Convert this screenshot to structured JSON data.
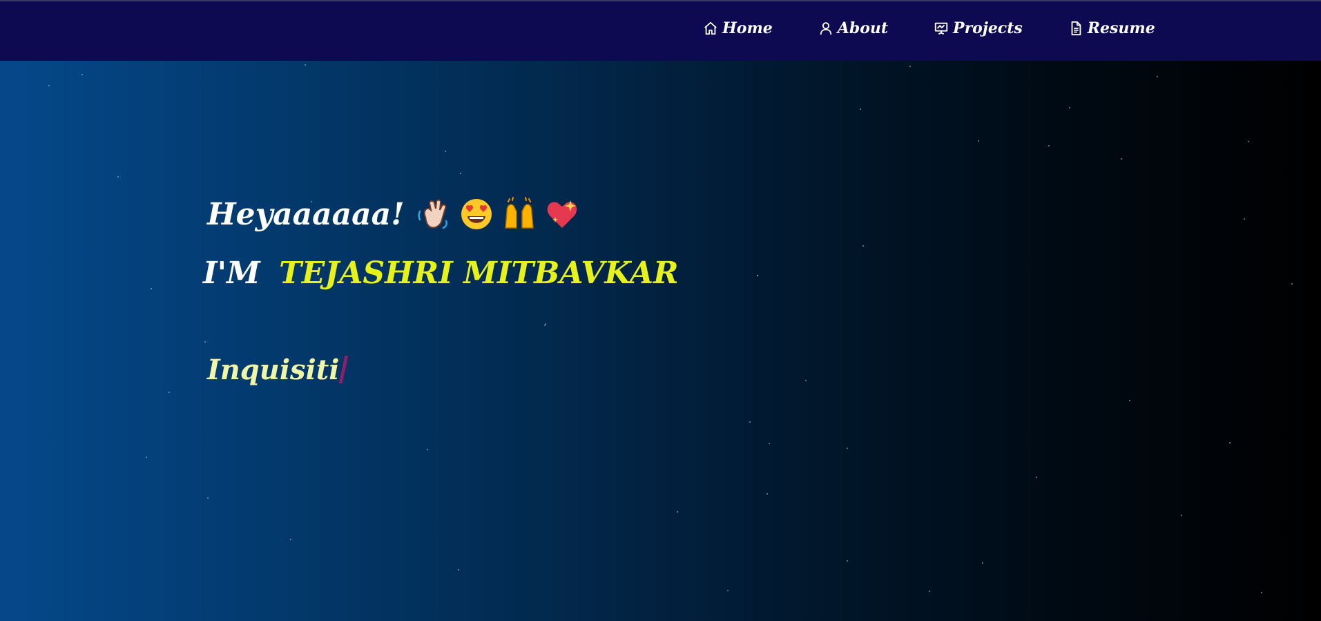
{
  "nav": {
    "items": [
      {
        "label": "Home",
        "icon": "home-icon"
      },
      {
        "label": "About",
        "icon": "user-icon"
      },
      {
        "label": "Projects",
        "icon": "presentation-icon"
      },
      {
        "label": "Resume",
        "icon": "document-icon"
      }
    ],
    "background": "#0e0a52",
    "text_color": "#ffffff"
  },
  "hero": {
    "greeting": "Heyaaaaaa!",
    "emojis": [
      "waving-hand-icon",
      "heart-eyes-face-icon",
      "raising-hands-icon",
      "sparkling-heart-icon"
    ],
    "intro_prefix": "I'M",
    "name": "TEJASHRI MITBAVKAR",
    "typed_text": "Inquisiti",
    "name_color": "#e6f21a",
    "typed_color": "#f0f5a8",
    "cursor_color": "#8a1f6a"
  },
  "background": {
    "gradient_start": "#05488a",
    "gradient_end": "#000000"
  }
}
